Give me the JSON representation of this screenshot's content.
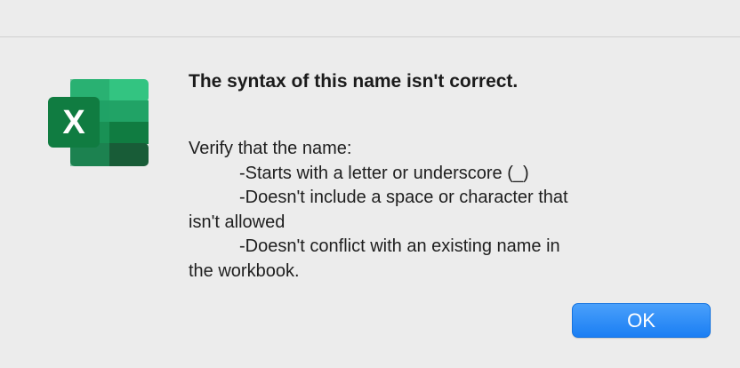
{
  "dialog": {
    "icon": "excel-app-icon",
    "icon_letter": "X",
    "title": "The syntax of this name isn't correct.",
    "message_lines": [
      "Verify that the name:",
      "-Starts with a letter or underscore (_)",
      "-Doesn't include a space or character that",
      "isn't allowed",
      "-Doesn't conflict with an existing name in",
      "the workbook."
    ],
    "ok_label": "OK"
  },
  "colors": {
    "background": "#ececec",
    "button": "#1a7ef3",
    "excel_green": "#1d6f42"
  }
}
